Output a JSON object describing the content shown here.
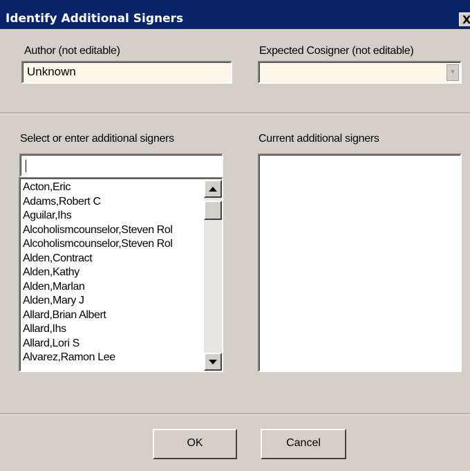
{
  "window": {
    "title": "Identify Additional Signers",
    "close_glyph": "X"
  },
  "author": {
    "label": "Author (not editable)",
    "value": "Unknown"
  },
  "cosigner": {
    "label": "Expected Cosigner (not editable)",
    "value": "",
    "dropdown_icon": "chevron-down-icon"
  },
  "select_signers": {
    "label": "Select or enter additional signers",
    "input_value": "",
    "items": [
      "Acton,Eric",
      "Adams,Robert C",
      "Aguilar,Ihs",
      "Alcoholismcounselor,Steven Rol",
      "Alcoholismcounselor,Steven Rol",
      "Alden,Contract",
      "Alden,Kathy",
      "Alden,Marlan",
      "Alden,Mary J",
      "Allard,Brian Albert",
      "Allard,Ihs",
      "Allard,Lori S",
      "Alvarez,Ramon Lee"
    ]
  },
  "current_signers": {
    "label": "Current additional signers",
    "items": []
  },
  "buttons": {
    "ok": "OK",
    "cancel": "Cancel"
  },
  "colors": {
    "titlebar": "#0a246a",
    "face": "#d4d0c8",
    "readonly_field": "#fbf8ea"
  }
}
